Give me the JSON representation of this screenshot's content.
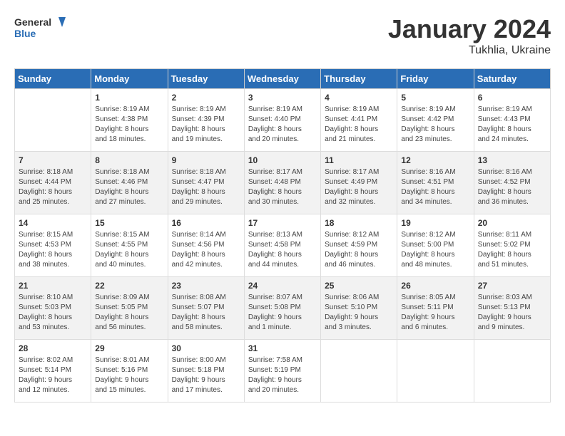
{
  "header": {
    "logo_general": "General",
    "logo_blue": "Blue",
    "month_year": "January 2024",
    "location": "Tukhlia, Ukraine"
  },
  "weekdays": [
    "Sunday",
    "Monday",
    "Tuesday",
    "Wednesday",
    "Thursday",
    "Friday",
    "Saturday"
  ],
  "weeks": [
    [
      {
        "day": "",
        "info": ""
      },
      {
        "day": "1",
        "info": "Sunrise: 8:19 AM\nSunset: 4:38 PM\nDaylight: 8 hours\nand 18 minutes."
      },
      {
        "day": "2",
        "info": "Sunrise: 8:19 AM\nSunset: 4:39 PM\nDaylight: 8 hours\nand 19 minutes."
      },
      {
        "day": "3",
        "info": "Sunrise: 8:19 AM\nSunset: 4:40 PM\nDaylight: 8 hours\nand 20 minutes."
      },
      {
        "day": "4",
        "info": "Sunrise: 8:19 AM\nSunset: 4:41 PM\nDaylight: 8 hours\nand 21 minutes."
      },
      {
        "day": "5",
        "info": "Sunrise: 8:19 AM\nSunset: 4:42 PM\nDaylight: 8 hours\nand 23 minutes."
      },
      {
        "day": "6",
        "info": "Sunrise: 8:19 AM\nSunset: 4:43 PM\nDaylight: 8 hours\nand 24 minutes."
      }
    ],
    [
      {
        "day": "7",
        "info": "Sunrise: 8:18 AM\nSunset: 4:44 PM\nDaylight: 8 hours\nand 25 minutes."
      },
      {
        "day": "8",
        "info": "Sunrise: 8:18 AM\nSunset: 4:46 PM\nDaylight: 8 hours\nand 27 minutes."
      },
      {
        "day": "9",
        "info": "Sunrise: 8:18 AM\nSunset: 4:47 PM\nDaylight: 8 hours\nand 29 minutes."
      },
      {
        "day": "10",
        "info": "Sunrise: 8:17 AM\nSunset: 4:48 PM\nDaylight: 8 hours\nand 30 minutes."
      },
      {
        "day": "11",
        "info": "Sunrise: 8:17 AM\nSunset: 4:49 PM\nDaylight: 8 hours\nand 32 minutes."
      },
      {
        "day": "12",
        "info": "Sunrise: 8:16 AM\nSunset: 4:51 PM\nDaylight: 8 hours\nand 34 minutes."
      },
      {
        "day": "13",
        "info": "Sunrise: 8:16 AM\nSunset: 4:52 PM\nDaylight: 8 hours\nand 36 minutes."
      }
    ],
    [
      {
        "day": "14",
        "info": "Sunrise: 8:15 AM\nSunset: 4:53 PM\nDaylight: 8 hours\nand 38 minutes."
      },
      {
        "day": "15",
        "info": "Sunrise: 8:15 AM\nSunset: 4:55 PM\nDaylight: 8 hours\nand 40 minutes."
      },
      {
        "day": "16",
        "info": "Sunrise: 8:14 AM\nSunset: 4:56 PM\nDaylight: 8 hours\nand 42 minutes."
      },
      {
        "day": "17",
        "info": "Sunrise: 8:13 AM\nSunset: 4:58 PM\nDaylight: 8 hours\nand 44 minutes."
      },
      {
        "day": "18",
        "info": "Sunrise: 8:12 AM\nSunset: 4:59 PM\nDaylight: 8 hours\nand 46 minutes."
      },
      {
        "day": "19",
        "info": "Sunrise: 8:12 AM\nSunset: 5:00 PM\nDaylight: 8 hours\nand 48 minutes."
      },
      {
        "day": "20",
        "info": "Sunrise: 8:11 AM\nSunset: 5:02 PM\nDaylight: 8 hours\nand 51 minutes."
      }
    ],
    [
      {
        "day": "21",
        "info": "Sunrise: 8:10 AM\nSunset: 5:03 PM\nDaylight: 8 hours\nand 53 minutes."
      },
      {
        "day": "22",
        "info": "Sunrise: 8:09 AM\nSunset: 5:05 PM\nDaylight: 8 hours\nand 56 minutes."
      },
      {
        "day": "23",
        "info": "Sunrise: 8:08 AM\nSunset: 5:07 PM\nDaylight: 8 hours\nand 58 minutes."
      },
      {
        "day": "24",
        "info": "Sunrise: 8:07 AM\nSunset: 5:08 PM\nDaylight: 9 hours\nand 1 minute."
      },
      {
        "day": "25",
        "info": "Sunrise: 8:06 AM\nSunset: 5:10 PM\nDaylight: 9 hours\nand 3 minutes."
      },
      {
        "day": "26",
        "info": "Sunrise: 8:05 AM\nSunset: 5:11 PM\nDaylight: 9 hours\nand 6 minutes."
      },
      {
        "day": "27",
        "info": "Sunrise: 8:03 AM\nSunset: 5:13 PM\nDaylight: 9 hours\nand 9 minutes."
      }
    ],
    [
      {
        "day": "28",
        "info": "Sunrise: 8:02 AM\nSunset: 5:14 PM\nDaylight: 9 hours\nand 12 minutes."
      },
      {
        "day": "29",
        "info": "Sunrise: 8:01 AM\nSunset: 5:16 PM\nDaylight: 9 hours\nand 15 minutes."
      },
      {
        "day": "30",
        "info": "Sunrise: 8:00 AM\nSunset: 5:18 PM\nDaylight: 9 hours\nand 17 minutes."
      },
      {
        "day": "31",
        "info": "Sunrise: 7:58 AM\nSunset: 5:19 PM\nDaylight: 9 hours\nand 20 minutes."
      },
      {
        "day": "",
        "info": ""
      },
      {
        "day": "",
        "info": ""
      },
      {
        "day": "",
        "info": ""
      }
    ]
  ]
}
